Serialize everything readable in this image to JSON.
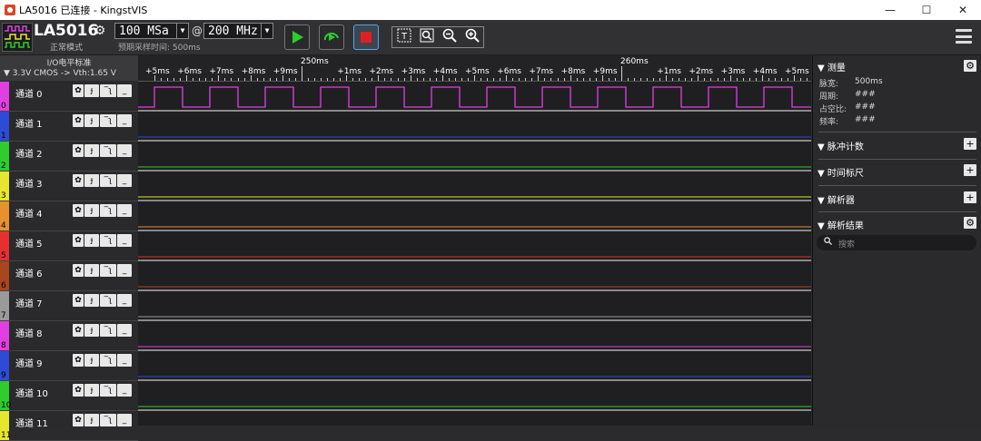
{
  "window": {
    "title": "LA5016 已连接 - KingstVIS",
    "minimize": "—",
    "maximize": "☐",
    "close": "✕"
  },
  "toolbar": {
    "device_name": "LA5016",
    "device_mode": "正常模式",
    "sample_depth": "100 MSa",
    "at_symbol": "@",
    "sample_rate": "200 MHz",
    "estimate": "预期采样时间: 500ms"
  },
  "io": {
    "title": "I/O电平标准",
    "standard": "▼ 3.3V CMOS  -> Vth:1.65 V"
  },
  "ruler": {
    "ticks": [
      "+5ms",
      "+6ms",
      "+7ms",
      "+8ms",
      "+9ms",
      "250ms",
      "+1ms",
      "+2ms",
      "+3ms",
      "+4ms",
      "+5ms",
      "+6ms",
      "+7ms",
      "+8ms",
      "+9ms",
      "260ms",
      "+1ms",
      "+2ms",
      "+3ms",
      "+4ms",
      "+5ms"
    ]
  },
  "channels": [
    {
      "num": "0",
      "name": "通道 0",
      "color": "#e040e0"
    },
    {
      "num": "1",
      "name": "通道 1",
      "color": "#2d4bd6"
    },
    {
      "num": "2",
      "name": "通道 2",
      "color": "#2ecc2e"
    },
    {
      "num": "3",
      "name": "通道 3",
      "color": "#e6e62e"
    },
    {
      "num": "4",
      "name": "通道 4",
      "color": "#e6902e"
    },
    {
      "num": "5",
      "name": "通道 5",
      "color": "#e63030"
    },
    {
      "num": "6",
      "name": "通道 6",
      "color": "#a8461e"
    },
    {
      "num": "7",
      "name": "通道 7",
      "color": "#9a9a9a"
    },
    {
      "num": "8",
      "name": "通道 8",
      "color": "#e040e0"
    },
    {
      "num": "9",
      "name": "通道 9",
      "color": "#2d4bd6"
    },
    {
      "num": "10",
      "name": "通道 10",
      "color": "#2ecc2e"
    },
    {
      "num": "11",
      "name": "通道 11",
      "color": "#e6e62e"
    }
  ],
  "channel_controls": [
    "✿",
    "ɟ",
    "‾ʅ",
    "_"
  ],
  "panel": {
    "measure": {
      "title": "▼ 测量",
      "rows": [
        {
          "label": "脉宽:",
          "value": "500ms"
        },
        {
          "label": "周期:",
          "value": "###"
        },
        {
          "label": "占空比:",
          "value": "###"
        },
        {
          "label": "频率:",
          "value": "###"
        }
      ]
    },
    "pulse_count": "▼ 脉冲计数",
    "time_marker": "▼ 时间标尺",
    "analyzer": "▼ 解析器",
    "analysis_result": "▼ 解析结果",
    "search_placeholder": "搜索"
  }
}
